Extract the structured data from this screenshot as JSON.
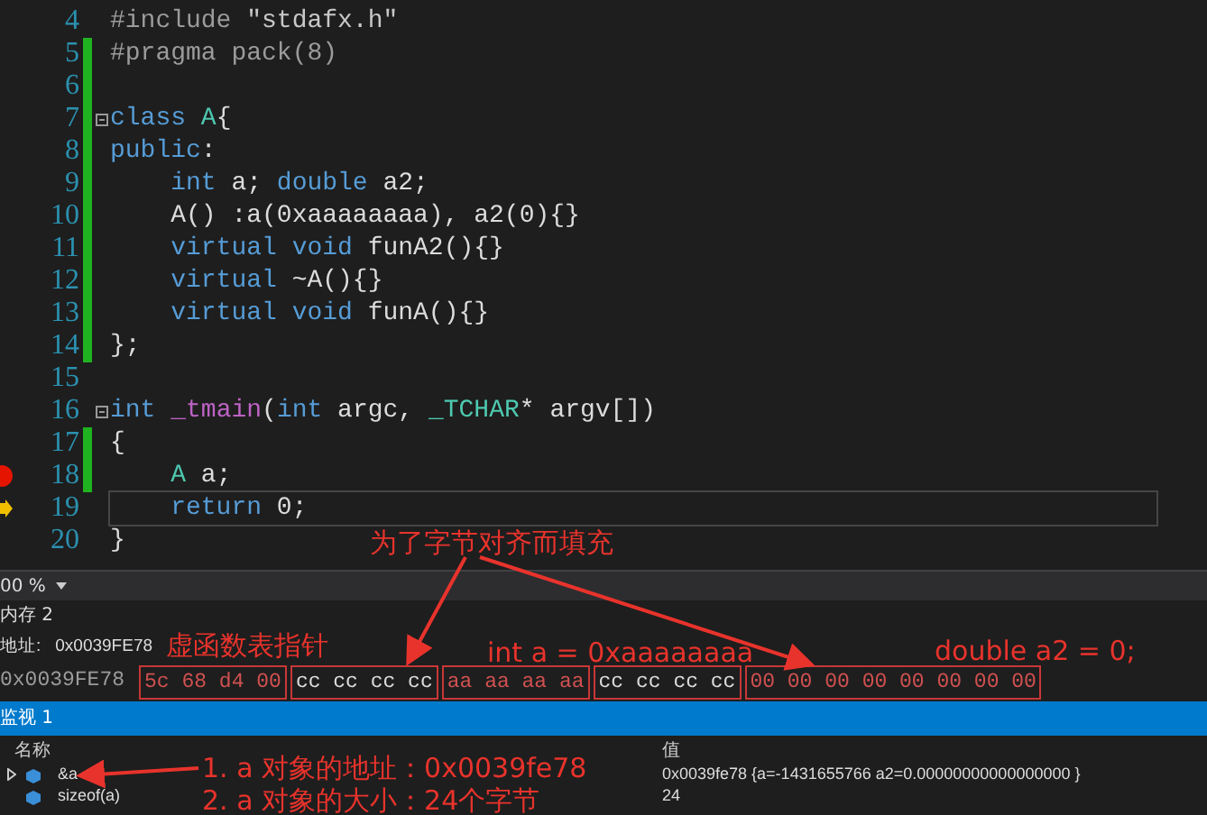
{
  "editor": {
    "lines": [
      {
        "number": "4",
        "changed": false,
        "fold": false,
        "breakpoint": false,
        "current": false,
        "tokens": [
          {
            "kind": "pp",
            "text": "#include"
          },
          {
            "kind": "str",
            "text": " \"stdafx.h\""
          }
        ]
      },
      {
        "number": "5",
        "changed": true,
        "fold": false,
        "breakpoint": false,
        "current": false,
        "tokens": [
          {
            "kind": "pp",
            "text": "#pragma pack(8)"
          }
        ]
      },
      {
        "number": "6",
        "changed": true,
        "fold": false,
        "breakpoint": false,
        "current": false
      },
      {
        "number": "7",
        "changed": true,
        "fold": true,
        "breakpoint": false,
        "current": false,
        "tokens": [
          {
            "kind": "kw",
            "text": "class"
          },
          {
            "kind": "type",
            "text": " A"
          },
          {
            "kind": "plain",
            "text": "{"
          }
        ]
      },
      {
        "number": "8",
        "changed": true,
        "fold": false,
        "breakpoint": false,
        "current": false,
        "tokens": [
          {
            "kind": "kw",
            "text": "public"
          },
          {
            "kind": "plain",
            "text": ":"
          }
        ]
      },
      {
        "number": "9",
        "changed": true,
        "fold": false,
        "breakpoint": false,
        "current": false,
        "tokens": [
          {
            "kind": "kw",
            "text": "    int"
          },
          {
            "kind": "plain",
            "text": " a; "
          },
          {
            "kind": "kw",
            "text": "double"
          },
          {
            "kind": "plain",
            "text": " a2;"
          }
        ]
      },
      {
        "number": "10",
        "changed": true,
        "fold": false,
        "breakpoint": false,
        "current": false,
        "tokens": [
          {
            "kind": "plain",
            "text": "    A() :a(0xaaaaaaaa), a2(0){}"
          }
        ]
      },
      {
        "number": "11",
        "changed": true,
        "fold": false,
        "breakpoint": false,
        "current": false,
        "tokens": [
          {
            "kind": "kw",
            "text": "    virtual void"
          },
          {
            "kind": "plain",
            "text": " funA2(){}"
          }
        ]
      },
      {
        "number": "12",
        "changed": true,
        "fold": false,
        "breakpoint": false,
        "current": false,
        "tokens": [
          {
            "kind": "kw",
            "text": "    virtual"
          },
          {
            "kind": "plain",
            "text": " ~A(){}"
          }
        ]
      },
      {
        "number": "13",
        "changed": true,
        "fold": false,
        "breakpoint": false,
        "current": false,
        "tokens": [
          {
            "kind": "kw",
            "text": "    virtual void"
          },
          {
            "kind": "plain",
            "text": " funA(){}"
          }
        ]
      },
      {
        "number": "14",
        "changed": true,
        "fold": false,
        "breakpoint": false,
        "current": false,
        "tokens": [
          {
            "kind": "plain",
            "text": "};"
          }
        ]
      },
      {
        "number": "15",
        "changed": false,
        "fold": false,
        "breakpoint": false,
        "current": false
      },
      {
        "number": "16",
        "changed": false,
        "fold": true,
        "breakpoint": false,
        "current": false,
        "tokens": [
          {
            "kind": "kw",
            "text": "int"
          },
          {
            "kind": "macro",
            "text": " _tmain"
          },
          {
            "kind": "plain",
            "text": "("
          },
          {
            "kind": "kw",
            "text": "int"
          },
          {
            "kind": "plain",
            "text": " argc, "
          },
          {
            "kind": "type",
            "text": "_TCHAR"
          },
          {
            "kind": "plain",
            "text": "* argv[])"
          }
        ]
      },
      {
        "number": "17",
        "changed": true,
        "fold": false,
        "breakpoint": false,
        "current": false,
        "tokens": [
          {
            "kind": "plain",
            "text": "{"
          }
        ]
      },
      {
        "number": "18",
        "changed": true,
        "fold": false,
        "breakpoint": true,
        "current": false,
        "tokens": [
          {
            "kind": "type",
            "text": "    A"
          },
          {
            "kind": "plain",
            "text": " a;"
          }
        ]
      },
      {
        "number": "19",
        "changed": false,
        "fold": false,
        "breakpoint": false,
        "current": true,
        "tokens": [
          {
            "kind": "kw",
            "text": "    return"
          },
          {
            "kind": "plain",
            "text": " 0;"
          }
        ]
      },
      {
        "number": "20",
        "changed": false,
        "fold": false,
        "breakpoint": false,
        "current": false,
        "tokens": [
          {
            "kind": "plain",
            "text": "}"
          }
        ]
      }
    ]
  },
  "zoom": "00 %",
  "memory": {
    "title": "内存 2",
    "address_label": "地址:",
    "address": "0x0039FE78",
    "row_address": "0x0039FE78",
    "groups": [
      {
        "bytes": "5c 68 d4 00",
        "changed": true
      },
      {
        "bytes": "cc cc cc cc",
        "changed": false
      },
      {
        "bytes": "aa aa aa aa",
        "changed": true
      },
      {
        "bytes": "cc cc cc cc",
        "changed": false
      },
      {
        "bytes": "00 00 00 00 00 00 00 00",
        "changed": true
      }
    ]
  },
  "watch": {
    "title": "监视 1",
    "columns": [
      "名称",
      "值"
    ],
    "rows": [
      {
        "name": "&a",
        "value": "0x0039fe78 {a=-1431655766 a2=0.00000000000000000 }",
        "expandable": true
      },
      {
        "name": "sizeof(a)",
        "value": "24",
        "expandable": false
      }
    ]
  },
  "annotations": [
    {
      "kind": "padding",
      "text": "为了字节对齐而填充"
    },
    {
      "kind": "vptr",
      "text": "虚函数表指针"
    },
    {
      "kind": "int",
      "text": "int a = 0xaaaaaaaa"
    },
    {
      "kind": "double",
      "text": "double a2 = 0;"
    },
    {
      "kind": "address",
      "text": "1. a 对象的地址：0x0039fe78"
    },
    {
      "kind": "size",
      "text": "2. a 对象的大小：24个字节"
    }
  ]
}
